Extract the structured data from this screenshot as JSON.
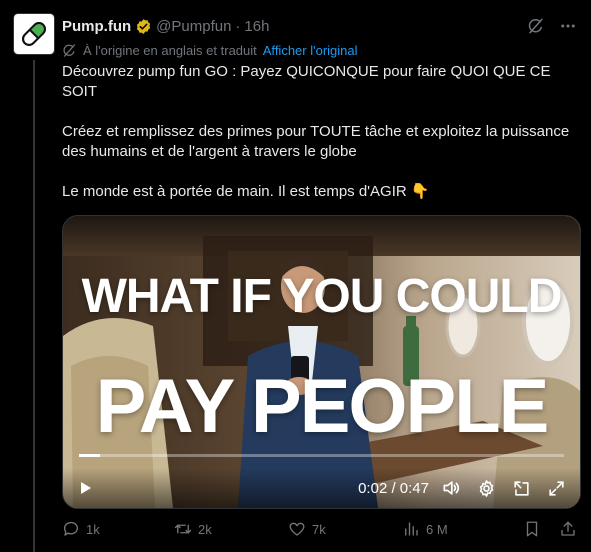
{
  "author": {
    "display_name": "Pump.fun",
    "handle": "@Pumpfun",
    "separator": "·",
    "time": "16h"
  },
  "translation": {
    "note": "À l'origine en anglais et traduit",
    "show_original": "Afficher l'original"
  },
  "tweet": {
    "paragraphs": [
      "Découvrez pump fun GO : Payez QUICONQUE pour faire QUOI QUE CE SOIT",
      "Créez et remplissez des primes pour TOUTE tâche et exploitez la puissance des humains et de l'argent à travers le globe",
      "Le monde est à portée de main. Il est temps d'AGIR 👇"
    ]
  },
  "video": {
    "overlay_line1": "WHAT IF YOU COULD",
    "overlay_line2": "PAY PEOPLE",
    "time_display": "0:02 / 0:47",
    "progress_fraction": 0.0426
  },
  "actions": {
    "replies": "1k",
    "reposts": "2k",
    "likes": "7k",
    "views": "6 M"
  },
  "colors": {
    "background": "#000000",
    "text": "#e7e9ea",
    "muted": "#71767b",
    "link": "#1d9bf0",
    "verified": "#e2b719"
  }
}
